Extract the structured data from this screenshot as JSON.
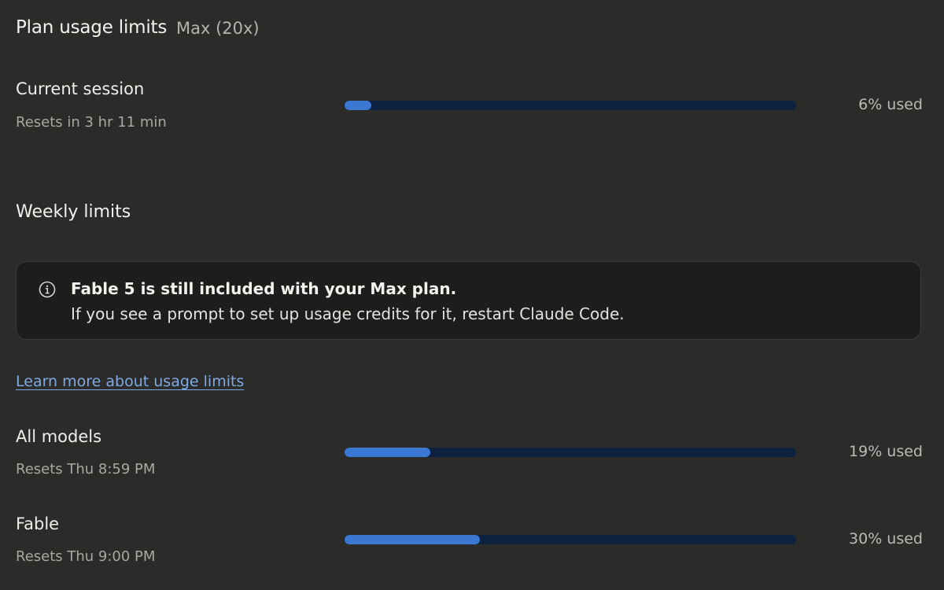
{
  "header": {
    "title": "Plan usage limits",
    "plan": "Max (20x)"
  },
  "current_session": {
    "title": "Current session",
    "reset": "Resets in 3 hr 11 min",
    "percent": 6,
    "percent_label": "6% used"
  },
  "weekly": {
    "title": "Weekly limits",
    "notice": {
      "icon": "info-icon",
      "strong": "Fable 5 is still included with your Max plan.",
      "text": "If you see a prompt to set up usage credits for it, restart Claude Code."
    },
    "learn_more": "Learn more about usage limits",
    "rows": [
      {
        "title": "All models",
        "reset": "Resets Thu 8:59 PM",
        "percent": 19,
        "percent_label": "19% used"
      },
      {
        "title": "Fable",
        "reset": "Resets Thu 9:00 PM",
        "percent": 30,
        "percent_label": "30% used"
      }
    ]
  },
  "colors": {
    "background": "#2b2b2a",
    "track": "#0d2140",
    "fill": "#3b78d3",
    "link": "#7fa9e3"
  }
}
